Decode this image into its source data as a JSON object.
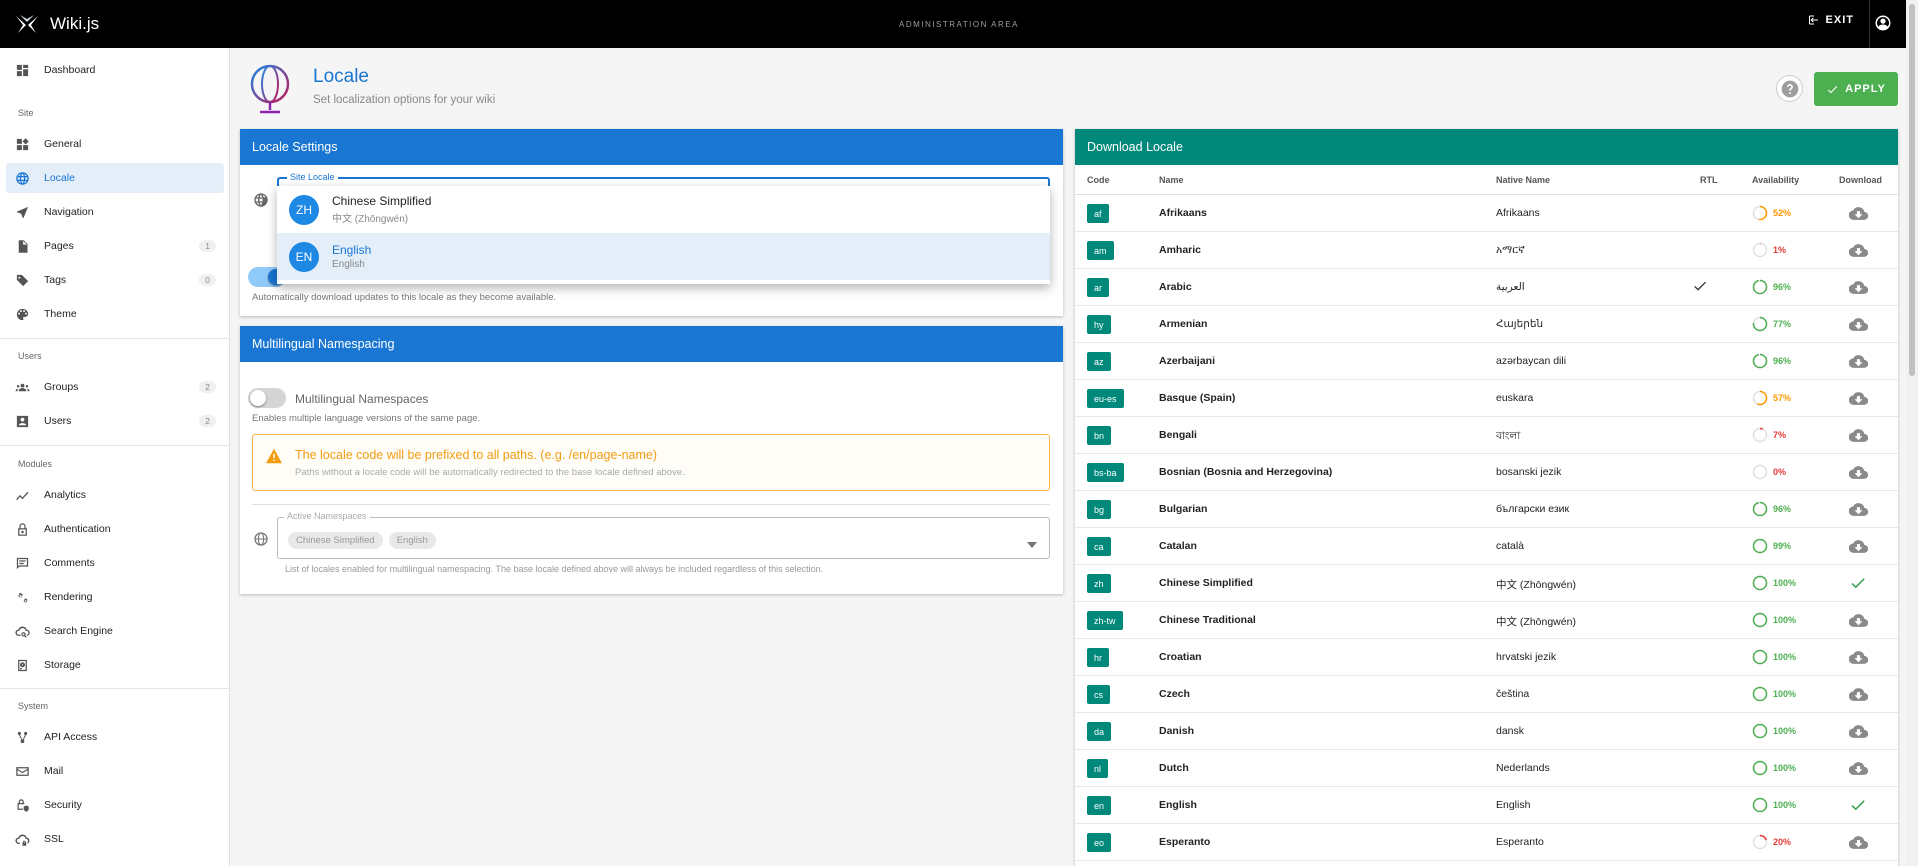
{
  "topbar": {
    "brand": "Wiki.js",
    "center": "ADMINISTRATION AREA",
    "exit": "EXIT"
  },
  "sidebar": {
    "dashboard": "Dashboard",
    "site_header": "Site",
    "general": "General",
    "locale": "Locale",
    "navigation": "Navigation",
    "pages": "Pages",
    "pages_count": "1",
    "tags": "Tags",
    "tags_count": "0",
    "theme": "Theme",
    "users_header": "Users",
    "groups": "Groups",
    "groups_count": "2",
    "users": "Users",
    "users_count": "2",
    "modules_header": "Modules",
    "analytics": "Analytics",
    "authentication": "Authentication",
    "comments": "Comments",
    "rendering": "Rendering",
    "search_engine": "Search Engine",
    "storage": "Storage",
    "system_header": "System",
    "api_access": "API Access",
    "mail": "Mail",
    "security": "Security",
    "ssl": "SSL"
  },
  "header": {
    "title": "Locale",
    "subtitle": "Set localization options for your wiki",
    "apply": "APPLY"
  },
  "locale_settings": {
    "title": "Locale Settings",
    "site_locale_label": "Site Locale",
    "auto_update_hint": "Automatically download updates to this locale as they become available."
  },
  "dropdown": {
    "items": [
      {
        "avatar": "ZH",
        "name": "Chinese Simplified",
        "native": "中文 (Zhōngwén)"
      },
      {
        "avatar": "EN",
        "name": "English",
        "native": "English"
      }
    ]
  },
  "namespacing": {
    "title": "Multilingual Namespacing",
    "toggle_label": "Multilingual Namespaces",
    "toggle_hint": "Enables multiple language versions of the same page.",
    "warn_title": "The locale code will be prefixed to all paths. (e.g. /en/page-name)",
    "warn_text": "Paths without a locale code will be automatically redirected to the base locale defined above.",
    "active_label": "Active Namespaces",
    "chips": [
      "Chinese Simplified",
      "English"
    ],
    "active_hint": "List of locales enabled for multilingual namespacing. The base locale defined above will always be included regardless of this selection."
  },
  "download": {
    "title": "Download Locale",
    "columns": {
      "code": "Code",
      "name": "Name",
      "native": "Native Name",
      "rtl": "RTL",
      "availability": "Availability",
      "download": "Download"
    },
    "rows": [
      {
        "code": "af",
        "name": "Afrikaans",
        "native": "Afrikaans",
        "rtl": false,
        "avail": "52%",
        "pct": 52,
        "installed": false
      },
      {
        "code": "am",
        "name": "Amharic",
        "native": "አማርኛ",
        "rtl": false,
        "avail": "1%",
        "pct": 1,
        "installed": false
      },
      {
        "code": "ar",
        "name": "Arabic",
        "native": "العربية",
        "rtl": true,
        "avail": "96%",
        "pct": 96,
        "installed": false
      },
      {
        "code": "hy",
        "name": "Armenian",
        "native": "Հայերեն",
        "rtl": false,
        "avail": "77%",
        "pct": 77,
        "installed": false
      },
      {
        "code": "az",
        "name": "Azerbaijani",
        "native": "azərbaycan dili",
        "rtl": false,
        "avail": "96%",
        "pct": 96,
        "installed": false
      },
      {
        "code": "eu-es",
        "name": "Basque (Spain)",
        "native": "euskara",
        "rtl": false,
        "avail": "57%",
        "pct": 57,
        "installed": false
      },
      {
        "code": "bn",
        "name": "Bengali",
        "native": "বাংলা",
        "rtl": false,
        "avail": "7%",
        "pct": 7,
        "installed": false
      },
      {
        "code": "bs-ba",
        "name": "Bosnian (Bosnia and Herzegovina)",
        "native": "bosanski jezik",
        "rtl": false,
        "avail": "0%",
        "pct": 0,
        "installed": false
      },
      {
        "code": "bg",
        "name": "Bulgarian",
        "native": "български език",
        "rtl": false,
        "avail": "96%",
        "pct": 96,
        "installed": false
      },
      {
        "code": "ca",
        "name": "Catalan",
        "native": "català",
        "rtl": false,
        "avail": "99%",
        "pct": 99,
        "installed": false
      },
      {
        "code": "zh",
        "name": "Chinese Simplified",
        "native": "中文 (Zhōngwén)",
        "rtl": false,
        "avail": "100%",
        "pct": 100,
        "installed": true
      },
      {
        "code": "zh-tw",
        "name": "Chinese Traditional",
        "native": "中文 (Zhōngwén)",
        "rtl": false,
        "avail": "100%",
        "pct": 100,
        "installed": false
      },
      {
        "code": "hr",
        "name": "Croatian",
        "native": "hrvatski jezik",
        "rtl": false,
        "avail": "100%",
        "pct": 100,
        "installed": false
      },
      {
        "code": "cs",
        "name": "Czech",
        "native": "čeština",
        "rtl": false,
        "avail": "100%",
        "pct": 100,
        "installed": false
      },
      {
        "code": "da",
        "name": "Danish",
        "native": "dansk",
        "rtl": false,
        "avail": "100%",
        "pct": 100,
        "installed": false
      },
      {
        "code": "nl",
        "name": "Dutch",
        "native": "Nederlands",
        "rtl": false,
        "avail": "100%",
        "pct": 100,
        "installed": false
      },
      {
        "code": "en",
        "name": "English",
        "native": "English",
        "rtl": false,
        "avail": "100%",
        "pct": 100,
        "installed": true
      },
      {
        "code": "eo",
        "name": "Esperanto",
        "native": "Esperanto",
        "rtl": false,
        "avail": "20%",
        "pct": 20,
        "installed": false
      }
    ]
  },
  "colors": {
    "primary": "#1976d2",
    "teal": "#00897b",
    "green": "#4caf50",
    "orange": "#ff9800",
    "red": "#e53935",
    "warn": "#f39c12"
  }
}
